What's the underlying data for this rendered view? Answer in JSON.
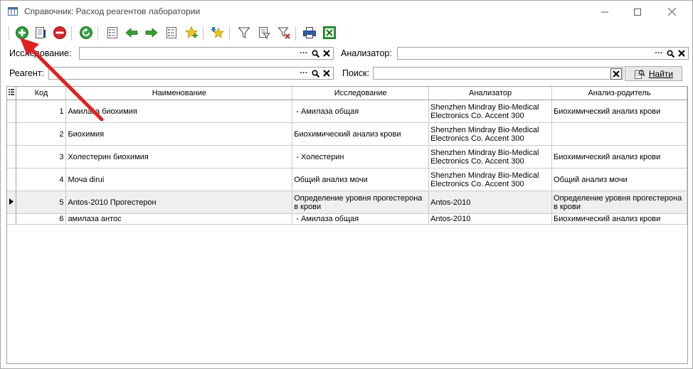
{
  "window": {
    "title": "Справочник: Расход реагентов лаборатории"
  },
  "toolbar": {
    "buttons": [
      {
        "icon": "add-icon"
      },
      {
        "icon": "edit-icon"
      },
      {
        "icon": "delete-icon"
      },
      {
        "icon": "refresh-icon"
      },
      {
        "icon": "list-icon"
      },
      {
        "icon": "arrow-left-icon"
      },
      {
        "icon": "arrow-right-icon"
      },
      {
        "icon": "list-copy-icon"
      },
      {
        "icon": "star-add-icon"
      },
      {
        "icon": "star-down-icon"
      },
      {
        "icon": "filter-icon"
      },
      {
        "icon": "filter-edit-icon"
      },
      {
        "icon": "filter-clear-icon"
      },
      {
        "icon": "print-icon"
      },
      {
        "icon": "excel-icon"
      }
    ]
  },
  "filters": {
    "research_label": "Исследование:",
    "research_value": "",
    "analyzer_label": "Анализатор:",
    "analyzer_value": "",
    "reagent_label": "Реагент:",
    "reagent_value": "",
    "search_label": "Поиск:",
    "search_value": "",
    "find_label": "Найти"
  },
  "table": {
    "columns": [
      "Код",
      "Наименование",
      "Исследование",
      "Анализатор",
      "Анализ-родитель"
    ],
    "rows": [
      {
        "code": "1",
        "name": "Амилаза биохимия",
        "research": " - Амилаза общая",
        "analyzer": "Shenzhen Mindray Bio-Medical Electronics Co. Accent 300",
        "parent": "Биохимический анализ крови"
      },
      {
        "code": "2",
        "name": "Биохимия",
        "research": "Биохимический анализ крови",
        "analyzer": "Shenzhen Mindray Bio-Medical Electronics Co. Accent 300",
        "parent": ""
      },
      {
        "code": "3",
        "name": "Холестерин биохимия",
        "research": " - Холестерин",
        "analyzer": "Shenzhen Mindray Bio-Medical Electronics Co. Accent 300",
        "parent": "Биохимический анализ крови"
      },
      {
        "code": "4",
        "name": "Моча dirui",
        "research": "Общий анализ мочи",
        "analyzer": "Shenzhen Mindray Bio-Medical Electronics Co. Accent 300",
        "parent": "Общий анализ мочи"
      },
      {
        "code": "5",
        "name": "Antos-2010 Прогестерон",
        "research": "Определение уровня прогестерона в крови",
        "analyzer": "Antos-2010",
        "parent": "Определение уровня прогестерона в крови"
      },
      {
        "code": "6",
        "name": "амилаза антос",
        "research": " - Амилаза общая",
        "analyzer": "Antos-2010",
        "parent": "Биохимический анализ крови"
      }
    ],
    "selected_row": 5
  },
  "colors": {
    "annotation_arrow": "#e02020",
    "selected_row": "#efefef"
  }
}
